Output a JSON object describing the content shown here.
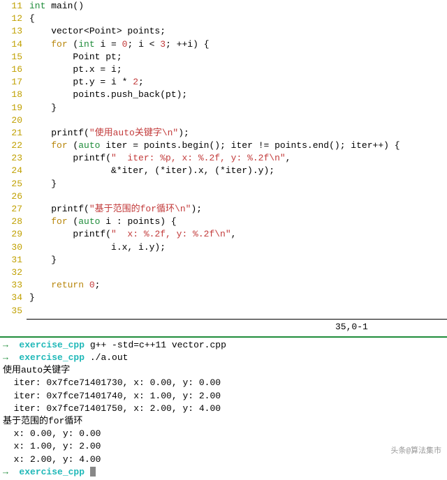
{
  "editor": {
    "lines": [
      {
        "n": "11",
        "tokens": [
          [
            "kw-type",
            "int"
          ],
          [
            "",
            " main()"
          ]
        ]
      },
      {
        "n": "12",
        "tokens": [
          [
            "",
            "{"
          ]
        ]
      },
      {
        "n": "13",
        "tokens": [
          [
            "",
            "    vector<Point> points;"
          ]
        ]
      },
      {
        "n": "14",
        "tokens": [
          [
            "",
            "    "
          ],
          [
            "kw-ctrl",
            "for"
          ],
          [
            "",
            " ("
          ],
          [
            "kw-type",
            "int"
          ],
          [
            "",
            " i = "
          ],
          [
            "num",
            "0"
          ],
          [
            "",
            "; i < "
          ],
          [
            "num",
            "3"
          ],
          [
            "",
            "; ++i) {"
          ]
        ]
      },
      {
        "n": "15",
        "tokens": [
          [
            "",
            "        Point pt;"
          ]
        ]
      },
      {
        "n": "16",
        "tokens": [
          [
            "",
            "        pt.x = i;"
          ]
        ]
      },
      {
        "n": "17",
        "tokens": [
          [
            "",
            "        pt.y = i * "
          ],
          [
            "num",
            "2"
          ],
          [
            "",
            ";"
          ]
        ]
      },
      {
        "n": "18",
        "tokens": [
          [
            "",
            "        points.push_back(pt);"
          ]
        ]
      },
      {
        "n": "19",
        "tokens": [
          [
            "",
            "    }"
          ]
        ]
      },
      {
        "n": "20",
        "tokens": [
          [
            "",
            ""
          ]
        ]
      },
      {
        "n": "21",
        "tokens": [
          [
            "",
            "    printf("
          ],
          [
            "str",
            "\"使用auto关键字\\n\""
          ],
          [
            "",
            ");"
          ]
        ]
      },
      {
        "n": "22",
        "tokens": [
          [
            "",
            "    "
          ],
          [
            "kw-ctrl",
            "for"
          ],
          [
            "",
            " ("
          ],
          [
            "kw-type",
            "auto"
          ],
          [
            "",
            " iter = points.begin(); iter != points.end(); iter++) {"
          ]
        ]
      },
      {
        "n": "23",
        "tokens": [
          [
            "",
            "        printf("
          ],
          [
            "str",
            "\"  iter: %p, x: %.2f, y: %.2f\\n\""
          ],
          [
            "",
            ","
          ]
        ]
      },
      {
        "n": "24",
        "tokens": [
          [
            "",
            "               &*iter, (*iter).x, (*iter).y);"
          ]
        ]
      },
      {
        "n": "25",
        "tokens": [
          [
            "",
            "    }"
          ]
        ]
      },
      {
        "n": "26",
        "tokens": [
          [
            "",
            ""
          ]
        ]
      },
      {
        "n": "27",
        "tokens": [
          [
            "",
            "    printf("
          ],
          [
            "str",
            "\"基于范围的for循环\\n\""
          ],
          [
            "",
            ");"
          ]
        ]
      },
      {
        "n": "28",
        "tokens": [
          [
            "",
            "    "
          ],
          [
            "kw-ctrl",
            "for"
          ],
          [
            "",
            " ("
          ],
          [
            "kw-type",
            "auto"
          ],
          [
            "",
            " i : points) {"
          ]
        ]
      },
      {
        "n": "29",
        "tokens": [
          [
            "",
            "        printf("
          ],
          [
            "str",
            "\"  x: %.2f, y: %.2f\\n\""
          ],
          [
            "",
            ","
          ]
        ]
      },
      {
        "n": "30",
        "tokens": [
          [
            "",
            "               i.x, i.y);"
          ]
        ]
      },
      {
        "n": "31",
        "tokens": [
          [
            "",
            "    }"
          ]
        ]
      },
      {
        "n": "32",
        "tokens": [
          [
            "",
            ""
          ]
        ]
      },
      {
        "n": "33",
        "tokens": [
          [
            "",
            "    "
          ],
          [
            "kw-ctrl",
            "return"
          ],
          [
            "",
            " "
          ],
          [
            "num",
            "0"
          ],
          [
            "",
            ";"
          ]
        ]
      },
      {
        "n": "34",
        "tokens": [
          [
            "",
            "}"
          ]
        ]
      },
      {
        "n": "35",
        "tokens": [
          [
            "",
            ""
          ]
        ]
      }
    ],
    "position": "35,0-1"
  },
  "terminal": {
    "arrow": "→",
    "dir": "exercise_cpp",
    "cmd1": " g++ -std=c++11 vector.cpp",
    "cmd2": " ./a.out",
    "output": [
      "使用auto关键字",
      "  iter: 0x7fce71401730, x: 0.00, y: 0.00",
      "  iter: 0x7fce71401740, x: 1.00, y: 2.00",
      "  iter: 0x7fce71401750, x: 2.00, y: 4.00",
      "基于范围的for循环",
      "  x: 0.00, y: 0.00",
      "  x: 1.00, y: 2.00",
      "  x: 2.00, y: 4.00"
    ]
  },
  "watermark": "头条@算法集市"
}
